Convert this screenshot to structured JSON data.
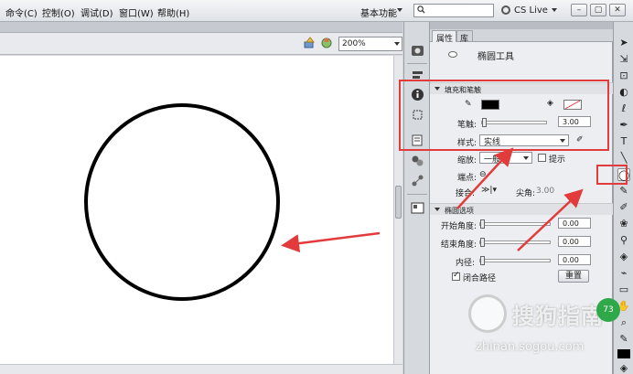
{
  "menu": {
    "items": [
      "命令(C)",
      "控制(O)",
      "调试(D)",
      "窗口(W)",
      "帮助(H)"
    ],
    "workspace": "基本功能",
    "search_placeholder": "",
    "cs_live": "CS Live"
  },
  "stage": {
    "zoom": "200%"
  },
  "panel": {
    "tabs": [
      "属性",
      "库"
    ],
    "active_tab": "属性",
    "tool_name": "椭圆工具",
    "fill_stroke": {
      "header": "填充和笔触",
      "stroke_color": "#000000",
      "fill_color": "none",
      "stroke_label": "笔触:",
      "stroke_value": "3.00",
      "style_label": "样式:",
      "style_value": "实线",
      "scale_label": "缩放:",
      "scale_value": "一般",
      "hint_label": "提示",
      "cap_label": "端点:",
      "join_label": "接合:",
      "miter_label": "尖角:",
      "miter_value": "3.00"
    },
    "ellipse_options": {
      "header": "椭圆选项",
      "start_angle_label": "开始角度:",
      "start_angle_value": "0.00",
      "end_angle_label": "结束角度:",
      "end_angle_value": "0.00",
      "inner_radius_label": "内径:",
      "inner_radius_value": "0.00",
      "close_path_label": "闭合路径",
      "close_path_checked": true,
      "reset_label": "重置"
    }
  },
  "watermark": {
    "text": "搜狗指南",
    "url": "zhinan.sogou.com"
  },
  "badge": "73",
  "colors": {
    "annotation_red": "#e23b3b",
    "stage_bg": "#ffffff",
    "circle_stroke": "#000000"
  }
}
